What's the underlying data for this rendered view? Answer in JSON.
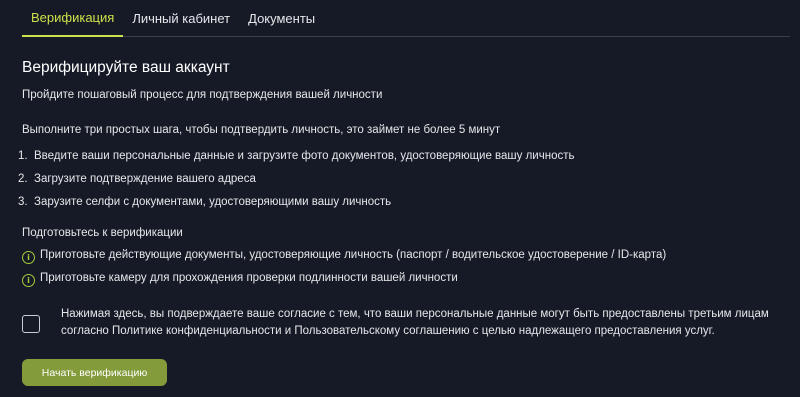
{
  "tabs": [
    {
      "label": "Верификация",
      "active": true
    },
    {
      "label": "Личный кабинет",
      "active": false
    },
    {
      "label": "Документы",
      "active": false
    }
  ],
  "main": {
    "title": "Верифицируйте ваш аккаунт",
    "subtitle": "Пройдите пошаговый процесс для подтверждения вашей личности",
    "intro": "Выполните три простых шага, чтобы подтвердить личность, это займет не более 5 минут",
    "steps": [
      {
        "num": "1.",
        "text": "Введите ваши персональные данные и загрузите фото документов, удостоверяющие вашу личность"
      },
      {
        "num": "2.",
        "text": "Загрузите подтверждение вашего адреса"
      },
      {
        "num": "3.",
        "text": "Зарузите селфи с документами, удостоверяющими вашу личность"
      }
    ],
    "prep_title": "Подготовьтесь к верификации",
    "prep_items": [
      {
        "icon": "info-icon",
        "text": "Приготовьте действующие документы, удостоверяющие личность (паспорт / водительское удостоверение / ID-карта)"
      },
      {
        "icon": "info-icon",
        "text": "Приготовьте камеру для прохождения проверки подлинности вашей личности"
      }
    ],
    "consent": {
      "checked": false,
      "text": "Нажимая здесь, вы подверждаете ваше согласие с тем, что ваши персональные данные могут быть предоставлены третьим лицам согласно Политике конфиденциальности и Пользовательскому соглашению с целью надлежащего предоставления услуг."
    },
    "start_button": "Начать верификацию"
  },
  "colors": {
    "background": "#161a26",
    "accent": "#cde14a",
    "icon": "#a4cc3d",
    "button": "#839b3b",
    "divider": "#3a3f4b"
  }
}
